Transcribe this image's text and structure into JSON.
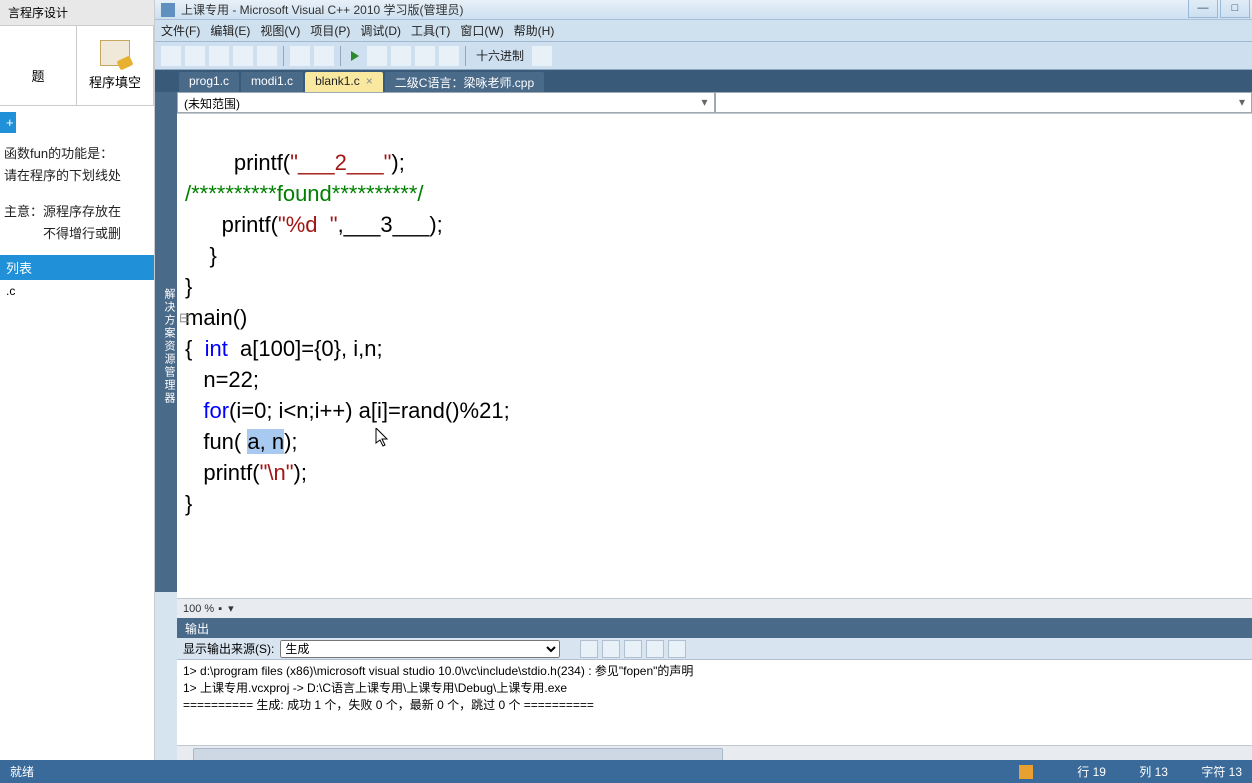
{
  "left": {
    "header": "言程序设计",
    "tab1": "题",
    "tab2": "程序填空",
    "plus": "+",
    "desc1": "函数fun的功能是：",
    "desc2": "请在程序的下划线处",
    "desc3": "主意：源程序存放在",
    "desc4": "　　　不得增行或删",
    "list_hdr": "列表",
    "list_item": ".c"
  },
  "title": "上课专用 - Microsoft Visual C++ 2010 学习版(管理员)",
  "menu": {
    "file": "文件(F)",
    "edit": "编辑(E)",
    "view": "视图(V)",
    "project": "项目(P)",
    "debug": "调试(D)",
    "tools": "工具(T)",
    "window": "窗口(W)",
    "help": "帮助(H)"
  },
  "toolbar": {
    "hex": "十六进制"
  },
  "side_label": "解决方案资源管理器",
  "tabs": {
    "t1": "prog1.c",
    "t2": "modi1.c",
    "t3": "blank1.c",
    "t4": "二级C语言：梁咏老师.cpp"
  },
  "scope": "(未知范围)",
  "code": {
    "l1a": "        printf(",
    "l1b": "\"___2___\"",
    "l1c": ");",
    "l2": "/**********found**********/",
    "l3a": "      printf(",
    "l3b": "\"%d  \"",
    "l3c": ",___3___);",
    "l4": "    }",
    "l5": "}",
    "l6a": "main()",
    "l7a": "{  ",
    "l7b": "int",
    "l7c": "  a[100]={0}, i,n;",
    "l8": "   n=22;",
    "l9a": "   ",
    "l9b": "for",
    "l9c": "(i=0; i<n;i++) a[i]=rand()%21;",
    "l10a": "   fun( ",
    "l10sel": "a, n",
    "l10b": ");",
    "l11a": "   printf(",
    "l11b": "\"\\n\"",
    "l11c": ");",
    "l12": "}"
  },
  "zoom": "100 %",
  "output": {
    "header": "输出",
    "src_label": "显示输出来源(S):",
    "src_value": "生成",
    "line1": "1>          d:\\program files (x86)\\microsoft visual studio 10.0\\vc\\include\\stdio.h(234) : 参见\"fopen\"的声明",
    "line2": "1>  上课专用.vcxproj -> D:\\C语言上课专用\\上课专用\\Debug\\上课专用.exe",
    "line3": "========== 生成: 成功 1 个，失败 0 个，最新 0 个，跳过 0 个 =========="
  },
  "status": {
    "ready": "就绪",
    "line": "行 19",
    "col": "列 13",
    "char": "字符 13"
  }
}
